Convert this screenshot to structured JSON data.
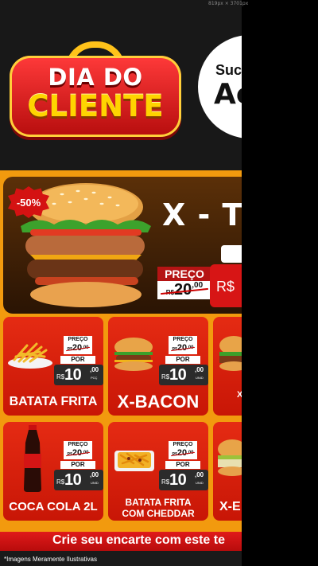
{
  "canvas": {
    "dimensions_label": "819px × 3701px"
  },
  "header": {
    "logo_line1": "DIA DO",
    "logo_line2": "CLIENTE",
    "badge_line1": "Suc",
    "badge_line2": "Ac"
  },
  "featured": {
    "discount": "-50%",
    "title": "X - TU",
    "price_label": "PREÇO",
    "old_currency": "R$",
    "old_int": "20",
    "old_cents": ",00",
    "new_currency": "R$"
  },
  "products": [
    {
      "name": "BATATA FRITA",
      "price_label": "PREÇO",
      "old_currency": "R$",
      "old_int": "20",
      "old_cents": ",00",
      "por": "POR",
      "currency": "R$",
      "price_int": "10",
      "price_cents": ",00",
      "unit": "PCÇ"
    },
    {
      "name": "X-BACON",
      "price_label": "PREÇO",
      "old_currency": "R$",
      "old_int": "20",
      "old_cents": ",00",
      "por": "POR",
      "currency": "R$",
      "price_int": "10",
      "price_cents": ",00",
      "unit": "UNID"
    },
    {
      "name": "X-",
      "partial": true
    },
    {
      "name": "COCA COLA 2L",
      "price_label": "PREÇO",
      "old_currency": "R$",
      "old_int": "20",
      "old_cents": ",00",
      "por": "POR",
      "currency": "R$",
      "price_int": "10",
      "price_cents": ",00",
      "unit": "UNID"
    },
    {
      "name": "BATATA FRITA COM CHEDDAR",
      "name_line1": "BATATA FRITA",
      "name_line2": "COM CHEDDAR",
      "price_label": "PREÇO",
      "old_currency": "R$",
      "old_int": "20",
      "old_cents": ",00",
      "por": "POR",
      "currency": "R$",
      "price_int": "10",
      "price_cents": ",00",
      "unit": "UNID"
    },
    {
      "name": "X-E",
      "partial": true
    }
  ],
  "footer": {
    "cta": "Crie seu encarte com este te",
    "disclaimer": "*Imagens Meramente Ilustrativas"
  },
  "colors": {
    "brand_red": "#d71515",
    "brand_orange": "#f29a0e",
    "brand_yellow": "#ffd400",
    "dark": "#181818"
  }
}
